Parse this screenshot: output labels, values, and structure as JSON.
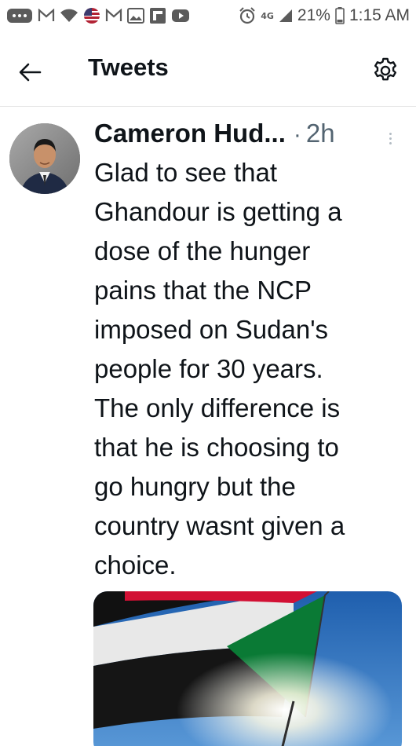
{
  "status_bar": {
    "battery_percent": "21%",
    "time": "1:15 AM",
    "network": "4G",
    "icons": [
      "messages-icon",
      "gmail-icon",
      "wifi-icon",
      "flag-icon",
      "gmail-icon",
      "gallery-icon",
      "flipboard-icon",
      "youtube-icon",
      "alarm-icon",
      "signal-icon",
      "battery-icon"
    ]
  },
  "header": {
    "title": "Tweets"
  },
  "tweet": {
    "author_name": "Cameron Hud...",
    "separator": "·",
    "time": "2h",
    "text_lines": [
      "Glad to see that",
      "Ghandour is getting a",
      "dose of the hunger",
      "pains that the NCP",
      "imposed on Sudan's",
      "people for 30 years.",
      "The only difference is",
      "that he is choosing to",
      "go hungry but the",
      "country wasnt given a",
      "choice."
    ],
    "media": "sudan-flag-photo"
  },
  "colors": {
    "text": "#0f1419",
    "secondary": "#536471",
    "flag_red": "#d21034",
    "flag_green": "#007229",
    "sky": "#3a7fc8"
  }
}
